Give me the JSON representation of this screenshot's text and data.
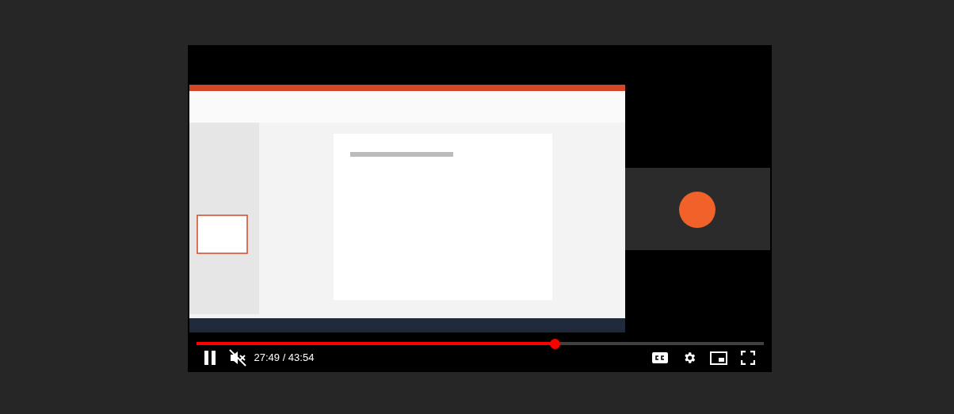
{
  "player": {
    "kind": "picture",
    "progress": {
      "level": 0.633
    },
    "paused": false,
    "muted": true,
    "time": "27:49 / 43:54"
  }
}
